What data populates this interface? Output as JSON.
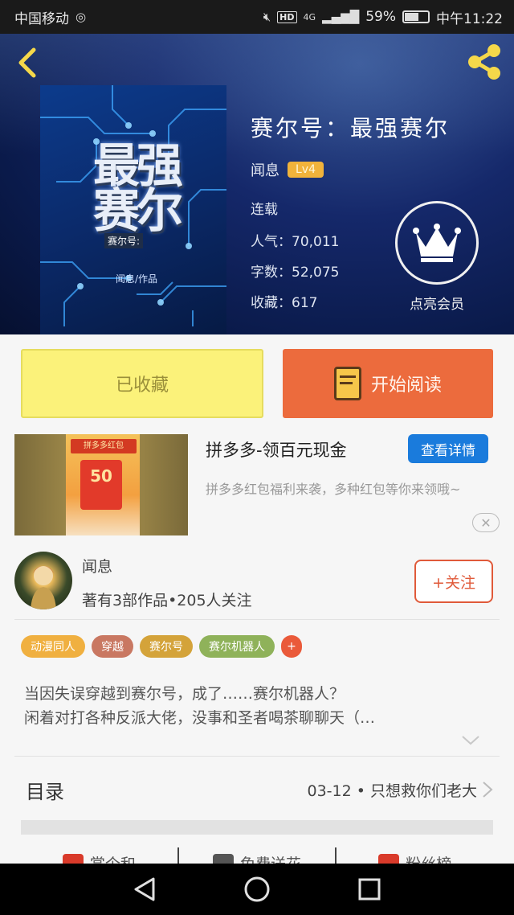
{
  "status_bar": {
    "carrier": "中国移动",
    "network": "4G",
    "battery": "59%",
    "battery_level": 0.59,
    "time": "中午11:22"
  },
  "book": {
    "cover_title": "最强赛尔",
    "cover_series": "赛尔号:",
    "cover_author": "闻息/作品",
    "title": "赛尔号：最强赛尔",
    "author": "闻息",
    "level": "Lv4",
    "status": "连载",
    "popularity": "人气：70,011",
    "word_count": "字数：52,075",
    "favorites": "收藏：617",
    "vip_label": "点亮会员"
  },
  "buttons": {
    "collected": "已收藏",
    "start_reading": "开始阅读"
  },
  "ad": {
    "title": "拼多多-领百元现金",
    "detail": "查看详情",
    "description": "拼多多红包福利来袭，多种红包等你来领哦~",
    "banner_text": "拼多多红包",
    "amount": "50"
  },
  "author_card": {
    "name": "闻息",
    "stats": "著有3部作品•205人关注",
    "follow": "+关注"
  },
  "tags": [
    {
      "label": "动漫同人",
      "color": "#f0b040"
    },
    {
      "label": "穿越",
      "color": "#c97862"
    },
    {
      "label": "赛尔号",
      "color": "#d4a33a"
    },
    {
      "label": "赛尔机器人",
      "color": "#8fb25a"
    }
  ],
  "tag_more": "+",
  "synopsis": {
    "line1": "当因失误穿越到赛尔号，成了……赛尔机器人？",
    "line2": "闲着对打各种反派大佬，没事和圣者喝茶聊聊天（…"
  },
  "toc": {
    "label": "目录",
    "latest": "03-12 • 只想救你们老大"
  },
  "actions": [
    {
      "label": "赏个和",
      "color": "#d93a2a"
    },
    {
      "label": "免费送花",
      "color": "#555555"
    },
    {
      "label": "粉丝榜",
      "color": "#d93a2a"
    }
  ]
}
